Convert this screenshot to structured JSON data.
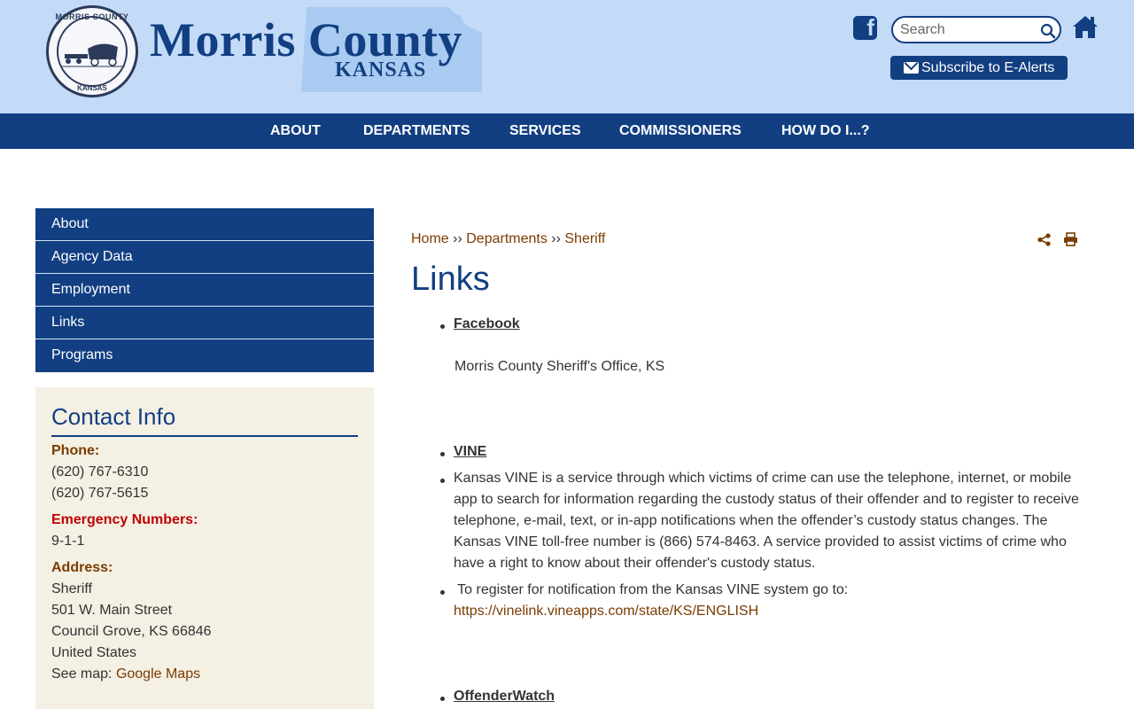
{
  "header": {
    "seal_top": "MORRIS COUNTY",
    "seal_bottom": "KANSAS",
    "title": "Morris County",
    "subtitle": "KANSAS",
    "search_placeholder": "Search",
    "subscribe_label": "Subscribe to E-Alerts",
    "icons": [
      "facebook-icon",
      "search-icon",
      "home-icon",
      "envelope-icon"
    ]
  },
  "nav": {
    "items": [
      {
        "label": "ABOUT"
      },
      {
        "label": "DEPARTMENTS"
      },
      {
        "label": "SERVICES"
      },
      {
        "label": "COMMISSIONERS"
      },
      {
        "label": "HOW DO I...?"
      }
    ]
  },
  "sidebar": {
    "items": [
      {
        "label": "About"
      },
      {
        "label": "Agency Data"
      },
      {
        "label": "Employment"
      },
      {
        "label": "Links"
      },
      {
        "label": "Programs"
      }
    ],
    "contact": {
      "title": "Contact Info",
      "phone_label": "Phone:",
      "phones": [
        "(620) 767-6310",
        "(620) 767-5615"
      ],
      "emergency_label": "Emergency Numbers:",
      "emergency": "9-1-1",
      "address_label": "Address:",
      "address": [
        "Sheriff",
        "501 W. Main Street",
        "Council Grove, KS 66846",
        "United States"
      ],
      "map_prefix": "See map: ",
      "map_link": "Google Maps"
    }
  },
  "main": {
    "breadcrumb": {
      "home": "Home",
      "sep": " ›› ",
      "departments": "Departments",
      "sheriff": "Sheriff"
    },
    "title": "Links",
    "facebook": {
      "label": "Facebook",
      "desc": "Morris County Sheriff's Office, KS"
    },
    "vine": {
      "label": "VINE",
      "description": "Kansas VINE is a service through which victims of crime can use the telephone, internet, or mobile app to search for information regarding the custody status of their offender and to register to receive telephone, e-mail, text, or in-app notifications when the offender’s custody status changes. The Kansas VINE toll-free number is (866) 574-8463. A service provided to assist victims of crime who have a right to know about their offender's custody status.",
      "register_text": " To register for notification from the Kansas VINE system go to:",
      "register_url": "https://vinelink.vineapps.com/state/KS/ENGLISH"
    },
    "offenderwatch": {
      "label": "OffenderWatch"
    }
  },
  "colors": {
    "header_bg": "#c3dbf7",
    "brand_blue": "#123f82",
    "link_brown": "#7a3c00",
    "emergency_red": "#c00000",
    "contact_bg": "#f4f0e4"
  }
}
